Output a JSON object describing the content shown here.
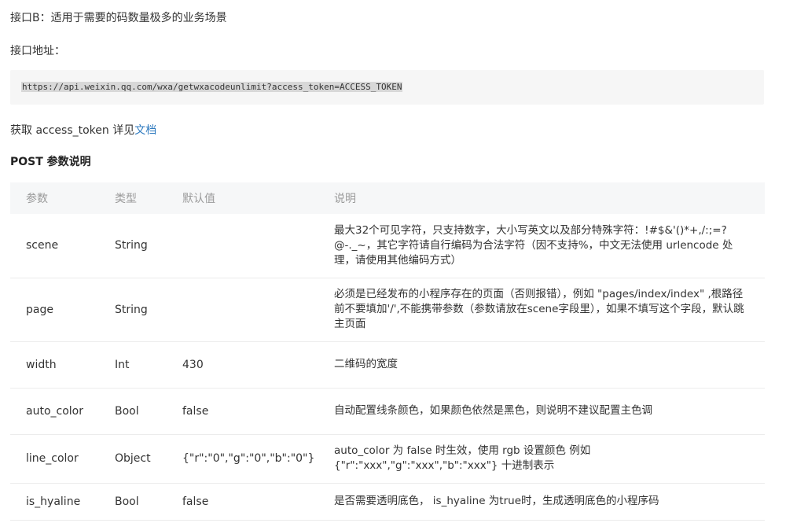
{
  "intro": "接口B：适用于需要的码数量极多的业务场景",
  "addr_label": "接口地址：",
  "api_url": "https://api.weixin.qq.com/wxa/getwxacodeunlimit?access_token=ACCESS_TOKEN",
  "token_text": "获取 access_token 详见",
  "token_link": "文档",
  "params_title": "POST 参数说明",
  "table": {
    "headers": [
      "参数",
      "类型",
      "默认值",
      "说明"
    ],
    "rows": [
      {
        "name": "scene",
        "type": "String",
        "default": "",
        "desc": "最大32个可见字符，只支持数字，大小写英文以及部分特殊字符：!#$&'()*+,/:;=?@-._~，其它字符请自行编码为合法字符（因不支持%，中文无法使用 urlencode 处理，请使用其他编码方式）"
      },
      {
        "name": "page",
        "type": "String",
        "default": "",
        "desc": "必须是已经发布的小程序存在的页面（否则报错），例如 \"pages/index/index\" ,根路径前不要填加'/',不能携带参数（参数请放在scene字段里），如果不填写这个字段，默认跳主页面"
      },
      {
        "name": "width",
        "type": "Int",
        "default": "430",
        "desc": "二维码的宽度"
      },
      {
        "name": "auto_color",
        "type": "Bool",
        "default": "false",
        "desc": "自动配置线条颜色，如果颜色依然是黑色，则说明不建议配置主色调"
      },
      {
        "name": "line_color",
        "type": "Object",
        "default": "{\"r\":\"0\",\"g\":\"0\",\"b\":\"0\"}",
        "desc": "auto_color 为 false 时生效，使用 rgb 设置颜色 例如 {\"r\":\"xxx\",\"g\":\"xxx\",\"b\":\"xxx\"} 十进制表示"
      },
      {
        "name": "is_hyaline",
        "type": "Bool",
        "default": "false",
        "desc": "是否需要透明底色， is_hyaline 为true时，生成透明底色的小程序码"
      }
    ]
  },
  "colors": {
    "link": "#2e7abf",
    "header_bg": "#f6f7f8",
    "code_bg": "#f6f6f6"
  }
}
